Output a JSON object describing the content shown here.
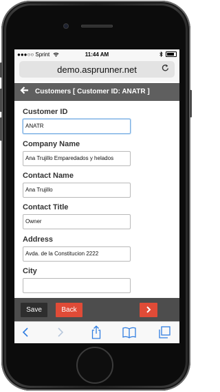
{
  "status_bar": {
    "carrier": "●●●○○ Sprint",
    "time": "11:44 AM"
  },
  "browser": {
    "url": "demo.asprunner.net",
    "reload_icon": "reload-icon"
  },
  "header": {
    "back_icon": "arrow-left-icon",
    "title": "Customers [ Customer ID: ANATR ]"
  },
  "form": {
    "fields": [
      {
        "label": "Customer ID",
        "value": "ANATR"
      },
      {
        "label": "Company Name",
        "value": "Ana Trujillo Emparedados y helados"
      },
      {
        "label": "Contact Name",
        "value": "Ana Trujillo"
      },
      {
        "label": "Contact Title",
        "value": "Owner"
      },
      {
        "label": "Address",
        "value": "Avda. de la Constitucion 2222"
      },
      {
        "label": "City",
        "value": ""
      }
    ]
  },
  "actions": {
    "save_label": "Save",
    "back_label": "Back",
    "next_label": "›"
  },
  "colors": {
    "title_bar": "#5f5f5f",
    "accent_red": "#e04b37",
    "save_button": "#2e2e2e",
    "focus_border": "#7fb2e5"
  }
}
